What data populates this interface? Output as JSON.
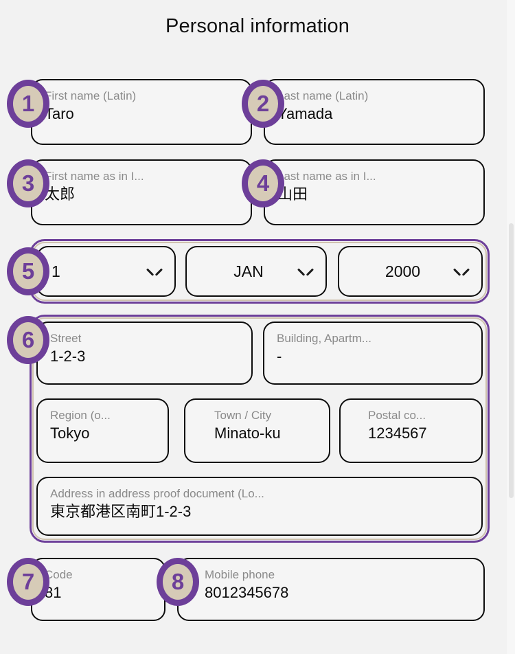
{
  "page": {
    "title": "Personal information",
    "background_color": "#f2f2f2",
    "accent_purple": "#6d3f99",
    "badge_fill": "#d6cbb7",
    "field_border": "#0c0c0c",
    "field_fill": "#f5f5f5",
    "label_color": "#8a8a8a"
  },
  "badges": {
    "b1": "1",
    "b2": "2",
    "b3": "3",
    "b4": "4",
    "b5": "5",
    "b6": "6",
    "b7": "7",
    "b8": "8"
  },
  "fields": {
    "first_name_latin": {
      "label": "First name (Latin)",
      "value": "Taro"
    },
    "last_name_latin": {
      "label": "Last name (Latin)",
      "value": "Yamada"
    },
    "first_name_id": {
      "label": "First name as in I...",
      "value": "太郎"
    },
    "last_name_id": {
      "label": "Last name as in I...",
      "value": "山田"
    },
    "street": {
      "label": "Street",
      "value": "1-2-3"
    },
    "building": {
      "label": "Building, Apartm...",
      "value": "-"
    },
    "region": {
      "label": "Region (o...",
      "value": "Tokyo"
    },
    "town_city": {
      "label": "Town / City",
      "value": "Minato-ku"
    },
    "postal_code": {
      "label": "Postal co...",
      "value": "1234567"
    },
    "address_proof": {
      "label": "Address in address proof document (Lo...",
      "value": "東京都港区南町1-2-3"
    },
    "phone_code": {
      "label": "Code",
      "value": "81"
    },
    "mobile_phone": {
      "label": "Mobile phone",
      "value": "8012345678"
    }
  },
  "date_of_birth": {
    "day": "1",
    "month": "JAN",
    "year": "2000"
  },
  "scrollbar": {
    "orientation": "vertical"
  }
}
